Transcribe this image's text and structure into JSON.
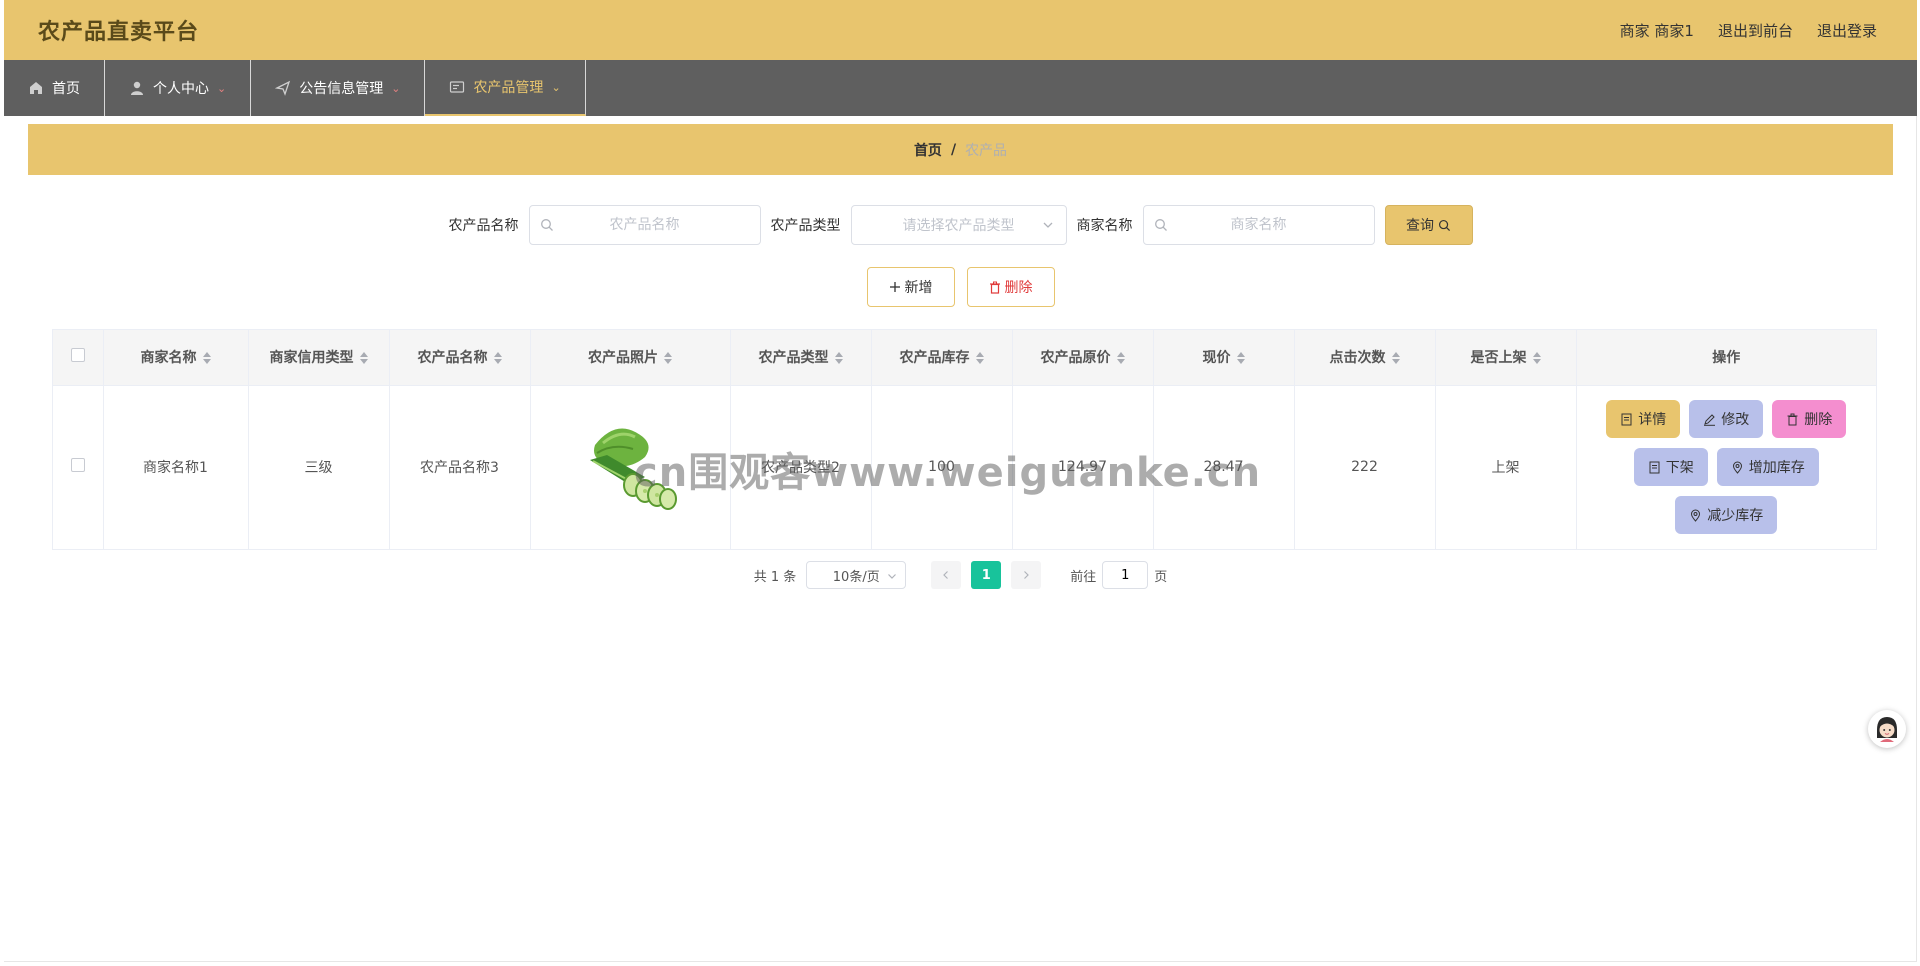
{
  "header": {
    "brand": "农产品直卖平台",
    "user_label": "商家 商家1",
    "to_front": "退出到前台",
    "logout": "退出登录"
  },
  "nav": {
    "items": [
      {
        "label": "首页",
        "icon": "home-icon"
      },
      {
        "label": "个人中心",
        "icon": "user-icon"
      },
      {
        "label": "公告信息管理",
        "icon": "send-icon"
      },
      {
        "label": "农产品管理",
        "icon": "list-icon"
      }
    ],
    "active_index": 3
  },
  "breadcrumb": {
    "home": "首页",
    "separator": "/",
    "current": "农产品"
  },
  "search": {
    "product_name_label": "农产品名称",
    "product_name_placeholder": "农产品名称",
    "product_type_label": "农产品类型",
    "product_type_placeholder": "请选择农产品类型",
    "merchant_name_label": "商家名称",
    "merchant_name_placeholder": "商家名称",
    "query_label": "查询"
  },
  "actions": {
    "add_label": "新增",
    "delete_label": "删除"
  },
  "table": {
    "columns": [
      "商家名称",
      "商家信用类型",
      "农产品名称",
      "农产品照片",
      "农产品类型",
      "农产品库存",
      "农产品原价",
      "现价",
      "点击次数",
      "是否上架",
      "操作"
    ],
    "rows": [
      {
        "merchant_name": "商家名称1",
        "credit_type": "三级",
        "product_name": "农产品名称3",
        "product_type": "农产品类型2",
        "stock": "100",
        "original_price": "124.97",
        "current_price": "28.47",
        "clicks": "222",
        "on_shelf": "上架",
        "ops": {
          "detail": "详情",
          "edit": "修改",
          "delete": "删除",
          "take_down": "下架",
          "add_stock": "增加库存",
          "reduce_stock": "减少库存"
        }
      }
    ]
  },
  "pagination": {
    "total": "共 1 条",
    "page_size": "10条/页",
    "current_page": "1",
    "goto_prefix": "前往",
    "goto_value": "1",
    "goto_suffix": "页"
  },
  "watermark": "cn围观客www.weiguanke.cn",
  "colors": {
    "header_bg": "#e8c56e",
    "nav_bg": "#5f5f5f",
    "accent": "#e8c56e",
    "page_active": "#18c39b",
    "op_blue": "#b8c0ea",
    "op_pink": "#f48ecf",
    "danger": "#e03a3a"
  }
}
